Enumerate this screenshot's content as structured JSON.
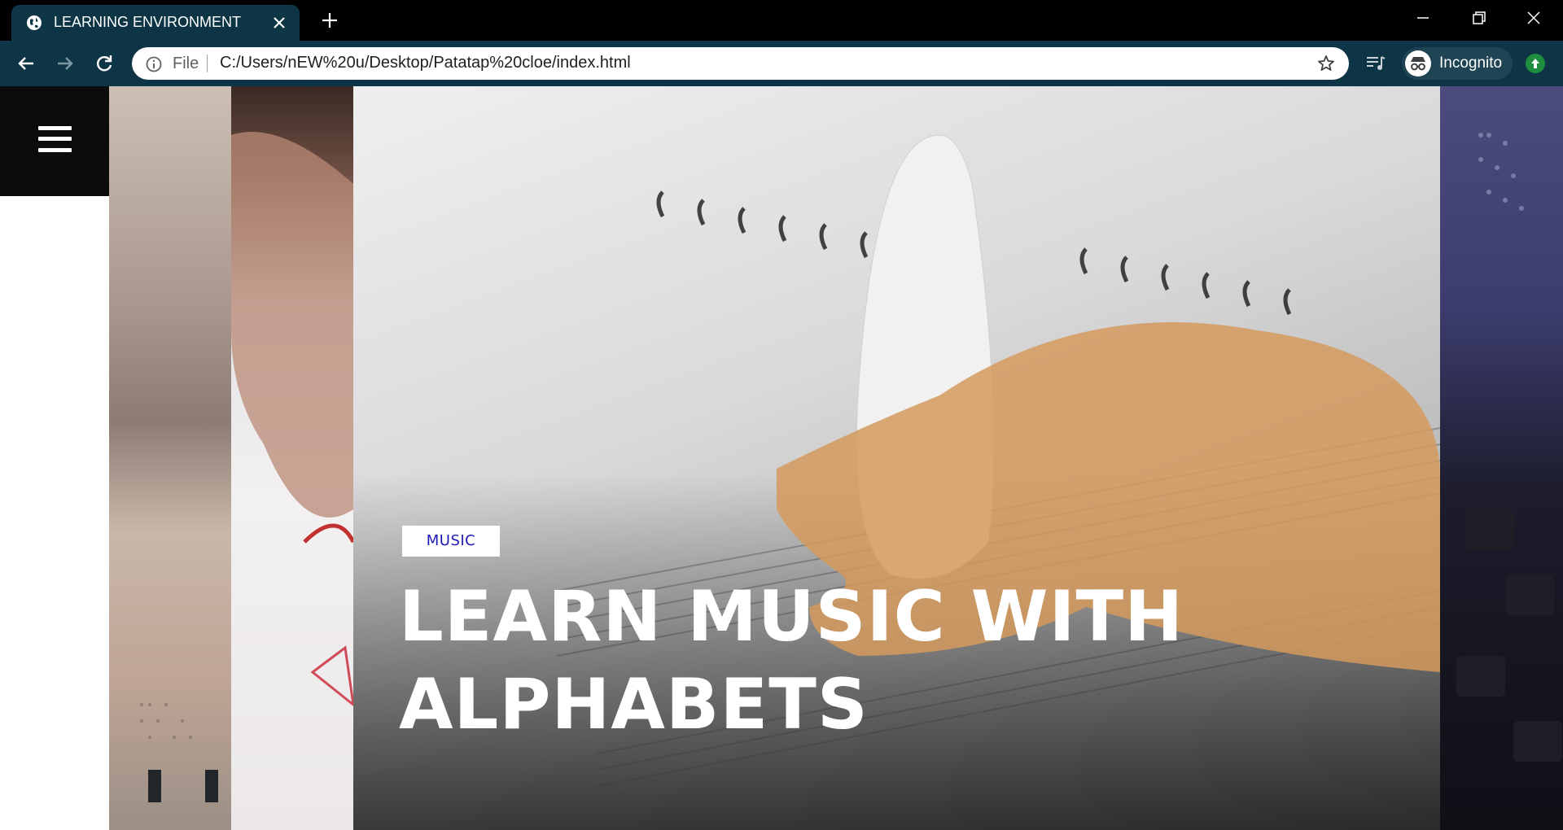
{
  "browser": {
    "tab_title": "LEARNING ENVIRONMENT",
    "address": {
      "scheme_label": "File",
      "url": "C:/Users/nEW%20u/Desktop/Patatap%20cloe/index.html"
    },
    "profile_label": "Incognito"
  },
  "page": {
    "category_tag": "MUSIC",
    "headline_line1": "LEARN MUSIC WITH",
    "headline_line2": "ALPHABETS"
  },
  "colors": {
    "tab_bar": "#000000",
    "toolbar": "#0d3546",
    "tag_text": "#1d19b8",
    "menu_bg": "#0c0c0c",
    "update_badge": "#1e8e3e"
  },
  "icons": {
    "tab": "globe-icon",
    "tab_close": "close-icon",
    "new_tab": "plus-icon",
    "back": "back-arrow-icon",
    "forward": "forward-arrow-icon",
    "reload": "reload-icon",
    "info": "info-icon",
    "bookmark": "star-icon",
    "media": "media-queue-icon",
    "incognito": "incognito-icon",
    "update": "update-arrow-icon",
    "menu": "hamburger-icon"
  }
}
